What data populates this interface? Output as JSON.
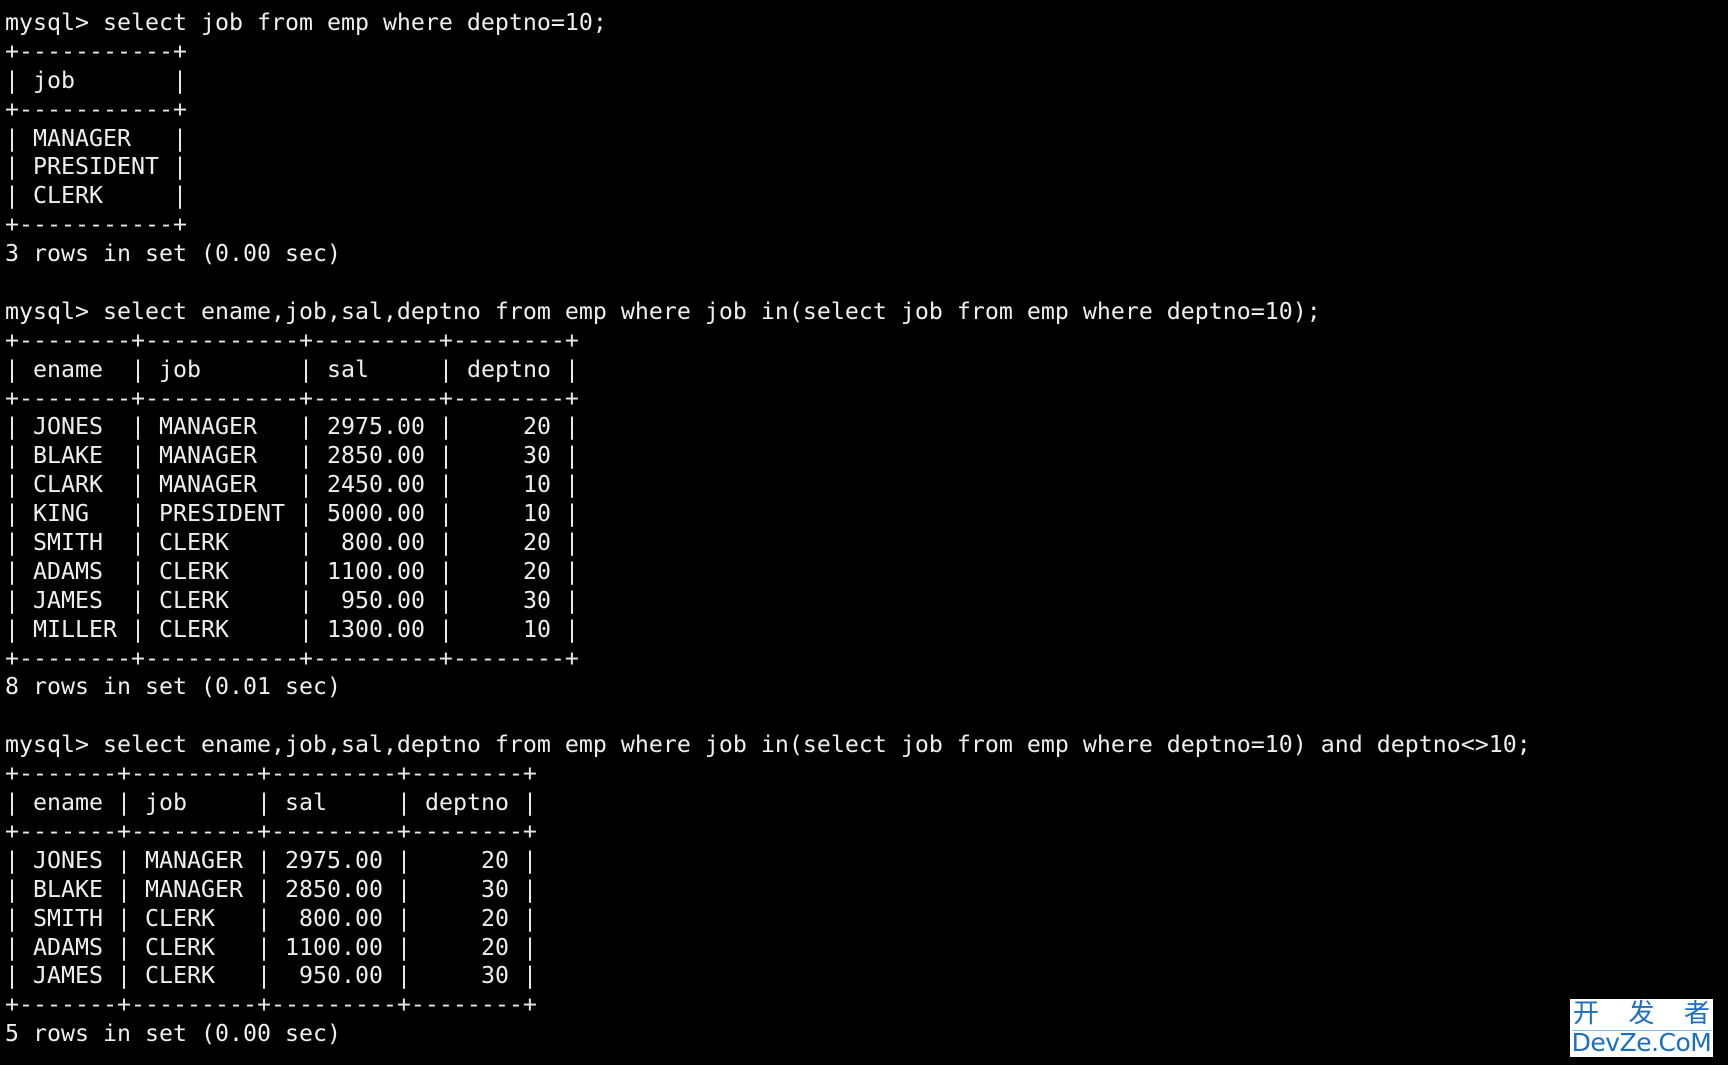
{
  "terminal": {
    "prompt": "mysql> ",
    "blocks": [
      {
        "command": "select job from emp where deptno=10;",
        "table": {
          "columns": [
            {
              "name": "job",
              "align": "left"
            }
          ],
          "rows": [
            [
              "MANAGER"
            ],
            [
              "PRESIDENT"
            ],
            [
              "CLERK"
            ]
          ]
        },
        "summary": "3 rows in set (0.00 sec)"
      },
      {
        "command": "select ename,job,sal,deptno from emp where job in(select job from emp where deptno=10);",
        "table": {
          "columns": [
            {
              "name": "ename",
              "align": "left"
            },
            {
              "name": "job",
              "align": "left"
            },
            {
              "name": "sal",
              "align": "right"
            },
            {
              "name": "deptno",
              "align": "right"
            }
          ],
          "rows": [
            [
              "JONES",
              "MANAGER",
              "2975.00",
              "20"
            ],
            [
              "BLAKE",
              "MANAGER",
              "2850.00",
              "30"
            ],
            [
              "CLARK",
              "MANAGER",
              "2450.00",
              "10"
            ],
            [
              "KING",
              "PRESIDENT",
              "5000.00",
              "10"
            ],
            [
              "SMITH",
              "CLERK",
              "800.00",
              "20"
            ],
            [
              "ADAMS",
              "CLERK",
              "1100.00",
              "20"
            ],
            [
              "JAMES",
              "CLERK",
              "950.00",
              "30"
            ],
            [
              "MILLER",
              "CLERK",
              "1300.00",
              "10"
            ]
          ]
        },
        "summary": "8 rows in set (0.01 sec)"
      },
      {
        "command": "select ename,job,sal,deptno from emp where job in(select job from emp where deptno=10) and deptno<>10;",
        "table": {
          "columns": [
            {
              "name": "ename",
              "align": "left"
            },
            {
              "name": "job",
              "align": "left"
            },
            {
              "name": "sal",
              "align": "right"
            },
            {
              "name": "deptno",
              "align": "right"
            }
          ],
          "rows": [
            [
              "JONES",
              "MANAGER",
              "2975.00",
              "20"
            ],
            [
              "BLAKE",
              "MANAGER",
              "2850.00",
              "30"
            ],
            [
              "SMITH",
              "CLERK",
              "800.00",
              "20"
            ],
            [
              "ADAMS",
              "CLERK",
              "1100.00",
              "20"
            ],
            [
              "JAMES",
              "CLERK",
              "950.00",
              "30"
            ]
          ]
        },
        "summary": "5 rows in set (0.00 sec)"
      }
    ]
  },
  "watermark": {
    "chinese_chars": [
      "开",
      "发",
      "者"
    ],
    "latin": "DevZe.CoM",
    "text_color": "#1a6fc0",
    "rule_color": "#7fc0ec",
    "background": "#ffffff"
  },
  "colors": {
    "background": "#000000",
    "foreground": "#eeeeee"
  }
}
